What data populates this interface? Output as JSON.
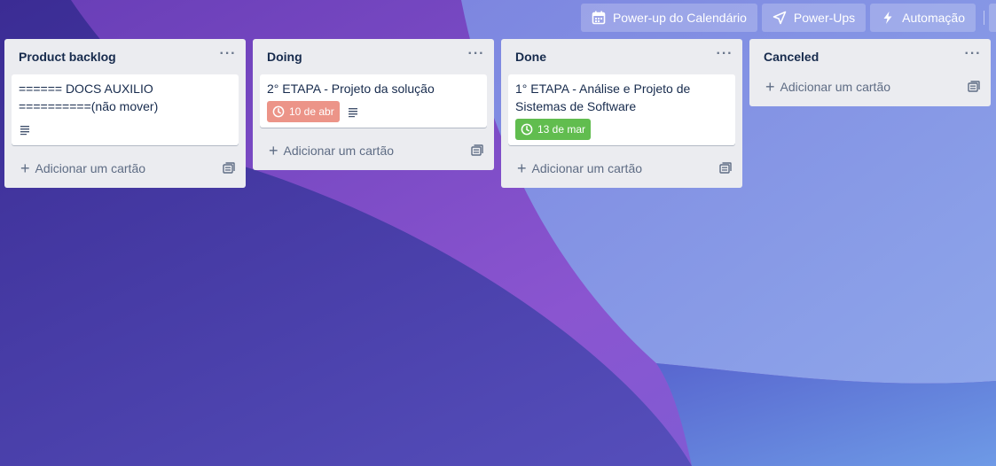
{
  "colors": {
    "bg_dark": "#3f2d96",
    "bg_purple": "#7a48c4",
    "bg_blue": "#6f8fe2",
    "due_overdue": "#ec9488",
    "due_complete": "#61bd4f"
  },
  "header": {
    "buttons": [
      {
        "icon": "calendar-icon",
        "label": "Power-up do Calendário"
      },
      {
        "icon": "rocket-icon",
        "label": "Power-Ups"
      },
      {
        "icon": "lightning-icon",
        "label": "Automação"
      }
    ]
  },
  "lists": [
    {
      "title": "Product backlog",
      "cards": [
        {
          "title": "====== DOCS AUXILIO ==========(não mover)",
          "has_description": true
        }
      ],
      "add_label": "Adicionar um cartão"
    },
    {
      "title": "Doing",
      "cards": [
        {
          "title": "2° ETAPA - Projeto da solução",
          "due": "10 de abr",
          "due_status": "overdue",
          "has_description": true
        }
      ],
      "add_label": "Adicionar um cartão"
    },
    {
      "title": "Done",
      "cards": [
        {
          "title": "1° ETAPA - Análise e Projeto de Sistemas de Software",
          "due": "13 de mar",
          "due_status": "complete",
          "has_description": false
        }
      ],
      "add_label": "Adicionar um cartão"
    },
    {
      "title": "Canceled",
      "cards": [],
      "add_label": "Adicionar um cartão"
    }
  ]
}
